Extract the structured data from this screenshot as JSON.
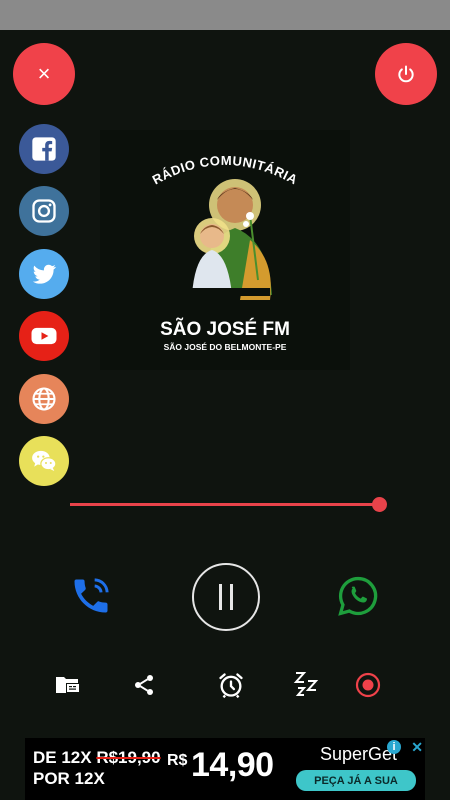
{
  "colors": {
    "accent": "#f0424a",
    "facebook": "#3b5998",
    "instagram": "#3f729b",
    "twitter": "#55acee",
    "youtube": "#e62117",
    "web": "#e6855a",
    "wechat": "#e8e05a",
    "call": "#1e6fe8",
    "whatsapp": "#1e9e3c"
  },
  "header": {
    "close_icon": "×",
    "power_icon": "power-icon"
  },
  "social_icons": [
    "facebook-icon",
    "instagram-icon",
    "twitter-icon",
    "youtube-icon",
    "globe-icon",
    "wechat-icon"
  ],
  "logo": {
    "arc_text": "RÁDIO COMUNITÁRIA",
    "name": "SÃO JOSÉ FM",
    "location": "SÃO JOSÉ DO BELMONTE-PE"
  },
  "player": {
    "volume_fraction": 0.97
  },
  "toolbar": {
    "sleep_label": "Zzz"
  },
  "ad": {
    "line1_prefix": "DE 12X ",
    "old_price": "R$19,90",
    "line2": "POR 12X",
    "currency": "R$",
    "price": "14,90",
    "brand": "SuperGet",
    "cta": "PEÇA JÁ A SUA"
  }
}
